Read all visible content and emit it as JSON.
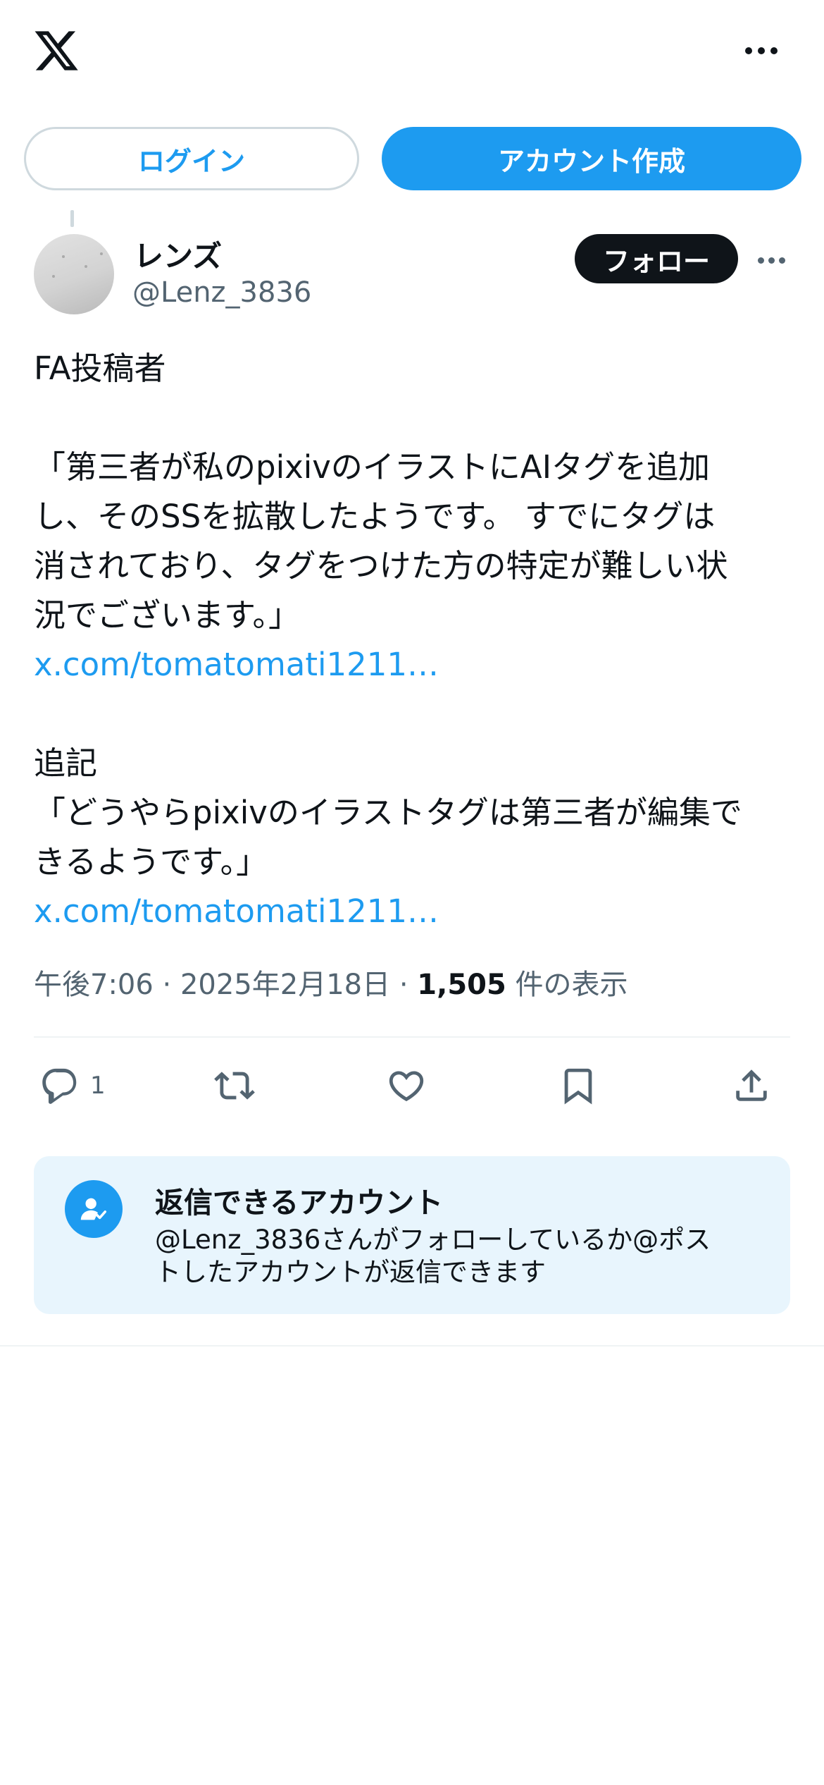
{
  "colors": {
    "accent": "#1d9bf0",
    "text_primary": "#0f1419",
    "text_secondary": "#536471",
    "reply_box_bg": "#e8f5fd",
    "follow_button_bg": "#0f1419"
  },
  "header": {
    "logo_icon": "x-logo-icon",
    "more_icon": "more-horizontal-icon"
  },
  "auth": {
    "login_label": "ログイン",
    "signup_label": "アカウント作成"
  },
  "author": {
    "display_name": "レンズ",
    "handle": "@Lenz_3836",
    "follow_label": "フォロー"
  },
  "tweet": {
    "line1": "FA投稿者",
    "quote1": [
      "「第三者が私のpixivのイラストにAIタグを追加",
      "し、そのSSを拡散したようです。 すでにタグは",
      "消されており、タグをつけた方の特定が難しい状",
      "況でございます。」"
    ],
    "link1": "x.com/tomatomati1211…",
    "addendum_label": "追記",
    "quote2": [
      "「どうやらpixivのイラストタグは第三者が編集で",
      "きるようです。」"
    ],
    "link2": "x.com/tomatomati1211…"
  },
  "meta": {
    "time": "午後7:06",
    "separator": " · ",
    "date": "2025年2月18日",
    "views_count": "1,505",
    "views_label": " 件の表示"
  },
  "actions": {
    "reply_icon": "reply-icon",
    "reply_count": "1",
    "retweet_icon": "retweet-icon",
    "like_icon": "heart-icon",
    "bookmark_icon": "bookmark-icon",
    "share_icon": "share-icon"
  },
  "reply_restriction": {
    "title": "返信できるアカウント",
    "desc_line1": "@Lenz_3836さんがフォローしているか@ポス",
    "desc_line2": "トしたアカウントが返信できます"
  }
}
